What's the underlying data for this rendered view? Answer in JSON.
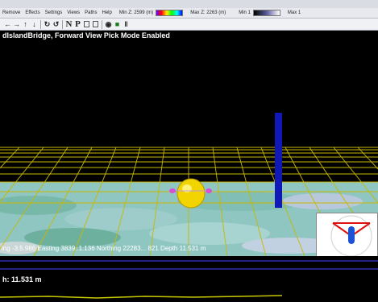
{
  "menu": {
    "items": [
      "Remove",
      "Effects",
      "Settings",
      "Views",
      "Paths",
      "Help"
    ],
    "min_z": "Min Z: 2599 (m)",
    "max_z": "Max Z: 2263 (m)",
    "min1": "Min 1",
    "max1": "Max 1"
  },
  "toolbar": {
    "icons": [
      "arrow-left-icon",
      "arrow-right-icon",
      "arrow-up-icon",
      "arrow-down-icon",
      "undo-icon",
      "redo-icon",
      "north-icon",
      "pick-icon",
      "layers-icon",
      "eye-icon",
      "stop-icon",
      "pause-icon"
    ],
    "n_label": "N",
    "p_label": "P"
  },
  "view": {
    "title": "dIslandBridge, Forward View  Pick Mode Enabled",
    "status": "ing  -3.5.986  Easting  3839..1.136  Northing  22283... 821  Depth  11.531 m",
    "depth_label": "h: 11.531 m",
    "colors": {
      "grid": "#c9b800",
      "seafloor": "#8fc6c2",
      "vehicle": "#f2d400",
      "pole": "#1019b8",
      "profile": "#c8c800"
    }
  }
}
